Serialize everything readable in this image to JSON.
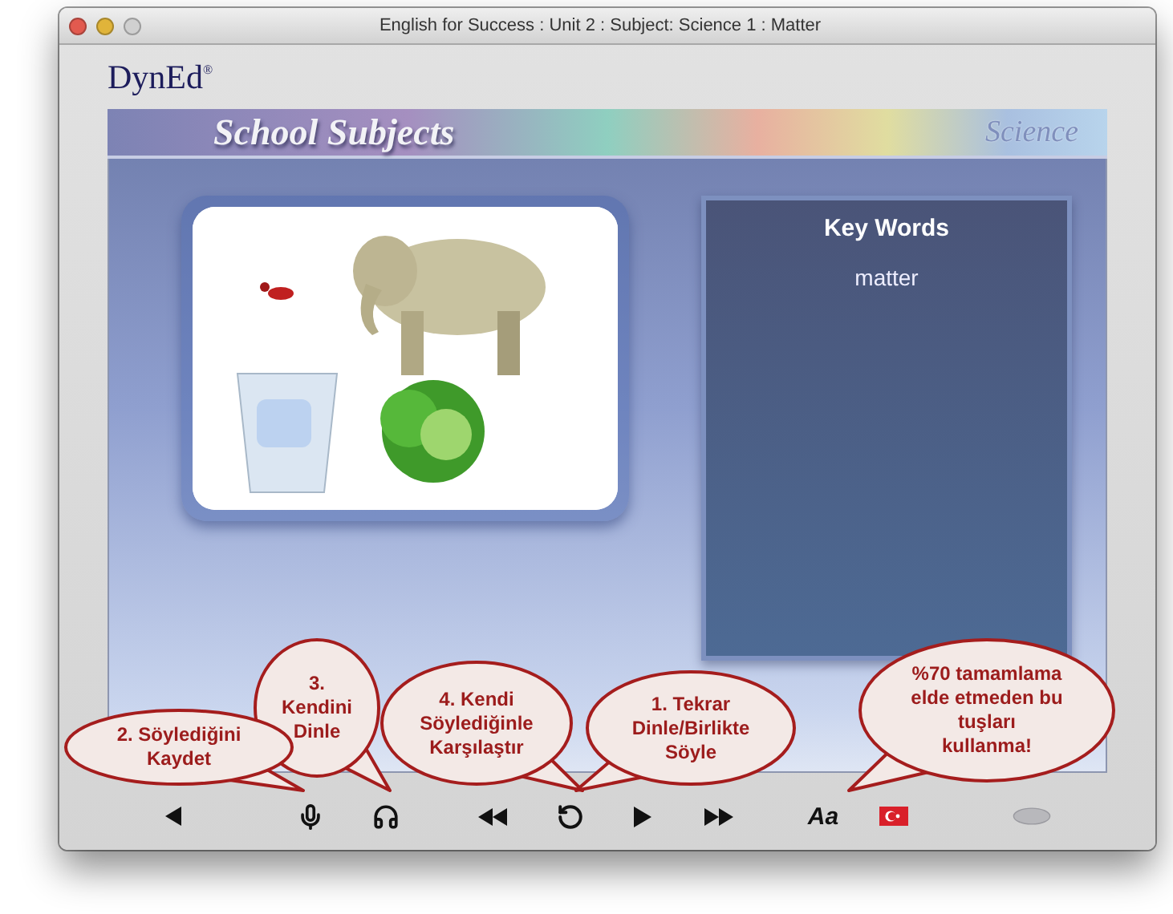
{
  "window": {
    "title": "English for Success : Unit 2 : Subject: Science 1 : Matter"
  },
  "logo": "DynEd$^{®}$",
  "banner": {
    "title": "School Subjects",
    "subject": "Science"
  },
  "key_words": {
    "title": "Key Words",
    "words": [
      "matter"
    ]
  },
  "toolbar": [
    {
      "kind": "back"
    },
    {
      "kind": "record"
    },
    {
      "kind": "listen"
    },
    {
      "kind": "rewind"
    },
    {
      "kind": "replay"
    },
    {
      "kind": "play"
    },
    {
      "kind": "forward"
    },
    {
      "kind": "font",
      "label": "Aa"
    },
    {
      "kind": "language"
    },
    {
      "kind": "oval"
    }
  ],
  "callouts": [
    {
      "lines": [
        "3.",
        "Kendini",
        "Dinle"
      ]
    },
    {
      "lines": [
        "2. Söylediğini",
        "Kaydet"
      ]
    },
    {
      "lines": [
        "4. Kendi",
        "Söylediğinle",
        "Karşılaştır"
      ]
    },
    {
      "lines": [
        "1. Tekrar",
        "Dinle/Birlikte",
        "Söyle"
      ]
    },
    {
      "lines": [
        "%70 tamamlama",
        "elde etmeden bu",
        "tuşları",
        "kullanma!"
      ]
    }
  ]
}
